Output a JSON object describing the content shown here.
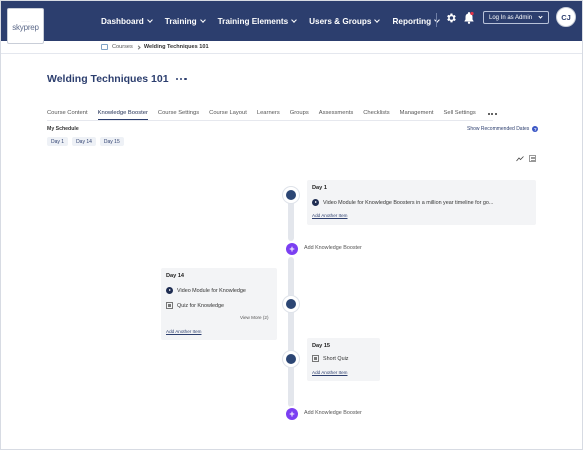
{
  "brand": {
    "top_text": "...........",
    "name": "skyprep"
  },
  "nav": {
    "items": [
      {
        "label": "Dashboard"
      },
      {
        "label": "Training"
      },
      {
        "label": "Training Elements"
      },
      {
        "label": "Users & Groups"
      },
      {
        "label": "Reporting"
      }
    ],
    "login_as": "Log In as Admin",
    "avatar": "CJ"
  },
  "breadcrumb": {
    "root": "Courses",
    "current": "Welding Techniques 101"
  },
  "page": {
    "title": "Welding Techniques 101"
  },
  "tabs": [
    {
      "label": "Course Content"
    },
    {
      "label": "Knowledge Booster"
    },
    {
      "label": "Course Settings"
    },
    {
      "label": "Course Layout"
    },
    {
      "label": "Learners"
    },
    {
      "label": "Groups"
    },
    {
      "label": "Assessments"
    },
    {
      "label": "Checklists"
    },
    {
      "label": "Management"
    },
    {
      "label": "Sell Settings"
    }
  ],
  "schedule": {
    "heading": "My Schedule",
    "show_recommended": "Show Recommended Dates",
    "help": "?",
    "days": [
      "Day 1",
      "Day 14",
      "Day 15"
    ]
  },
  "timeline": {
    "add_label": "Add Knowledge Booster",
    "day1": {
      "title": "Day 1",
      "items": [
        "Video Module for Knowledge Boosters in a million year timeline for go..."
      ],
      "add_another": "Add Another Item"
    },
    "day14": {
      "title": "Day 14",
      "items": [
        "Video Module for Knowledge",
        "Quiz for Knowledge"
      ],
      "view_more": "View More (2)",
      "add_another": "Add Another Item"
    },
    "day15": {
      "title": "Day 15",
      "items": [
        "Short Quiz"
      ],
      "add_another": "Add Another Item"
    }
  },
  "colors": {
    "nav_bg": "#2c3e6e",
    "accent": "#7b3ff2",
    "node": "#2c4674"
  }
}
